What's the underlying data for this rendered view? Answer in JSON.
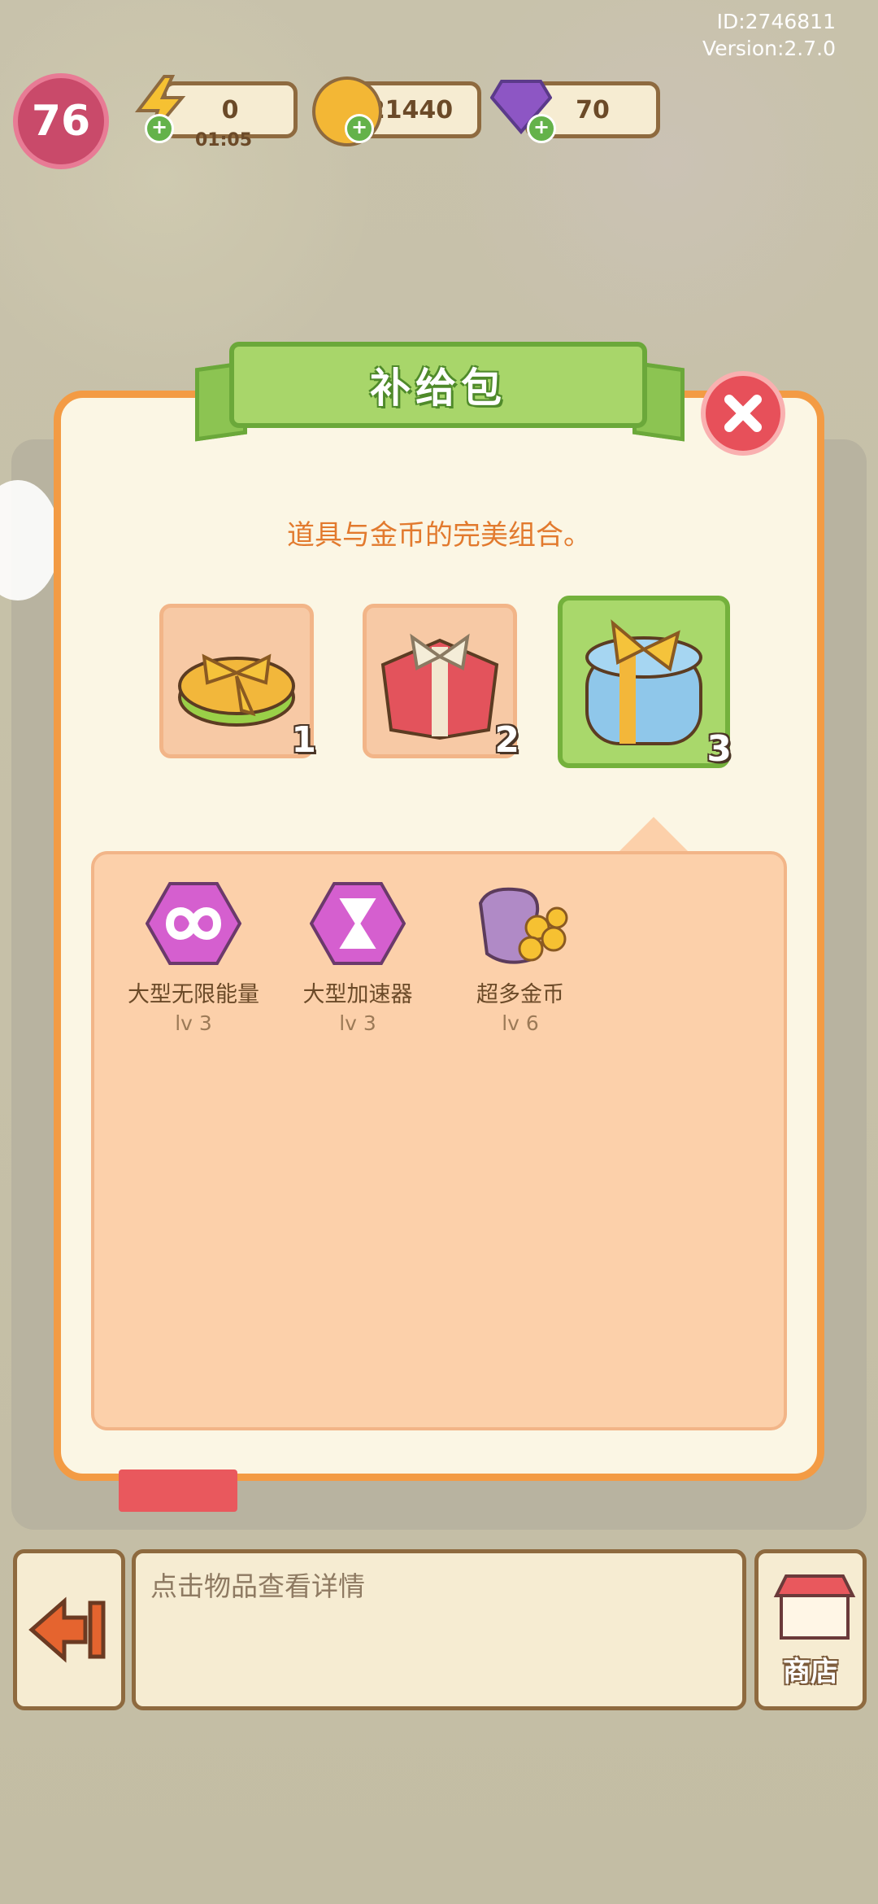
{
  "meta": {
    "id": "ID:2746811",
    "version": "Version:2.7.0"
  },
  "hud": {
    "level": "76",
    "energy": "0",
    "energy_timer": "01:05",
    "coins": "21440",
    "gems": "70"
  },
  "popup": {
    "title": "补给包",
    "subtitle": "道具与金币的完美组合。",
    "packs": [
      {
        "number": "1",
        "icon": "green-gift-icon"
      },
      {
        "number": "2",
        "icon": "red-gift-icon"
      },
      {
        "number": "3",
        "icon": "blue-gift-icon",
        "selected": true
      }
    ],
    "items": [
      {
        "name": "大型无限能量",
        "level": "lv 3",
        "icon": "infinity-energy-icon"
      },
      {
        "name": "大型加速器",
        "level": "lv 3",
        "icon": "hourglass-booster-icon"
      },
      {
        "name": "超多金币",
        "level": "lv 6",
        "icon": "coin-bag-icon"
      }
    ]
  },
  "bottom": {
    "info_text": "点击物品查看详情",
    "shop_label": "商店"
  },
  "colors": {
    "accent_orange": "#f39b44",
    "title_green": "#a8d66a",
    "close_red": "#e7505a"
  }
}
